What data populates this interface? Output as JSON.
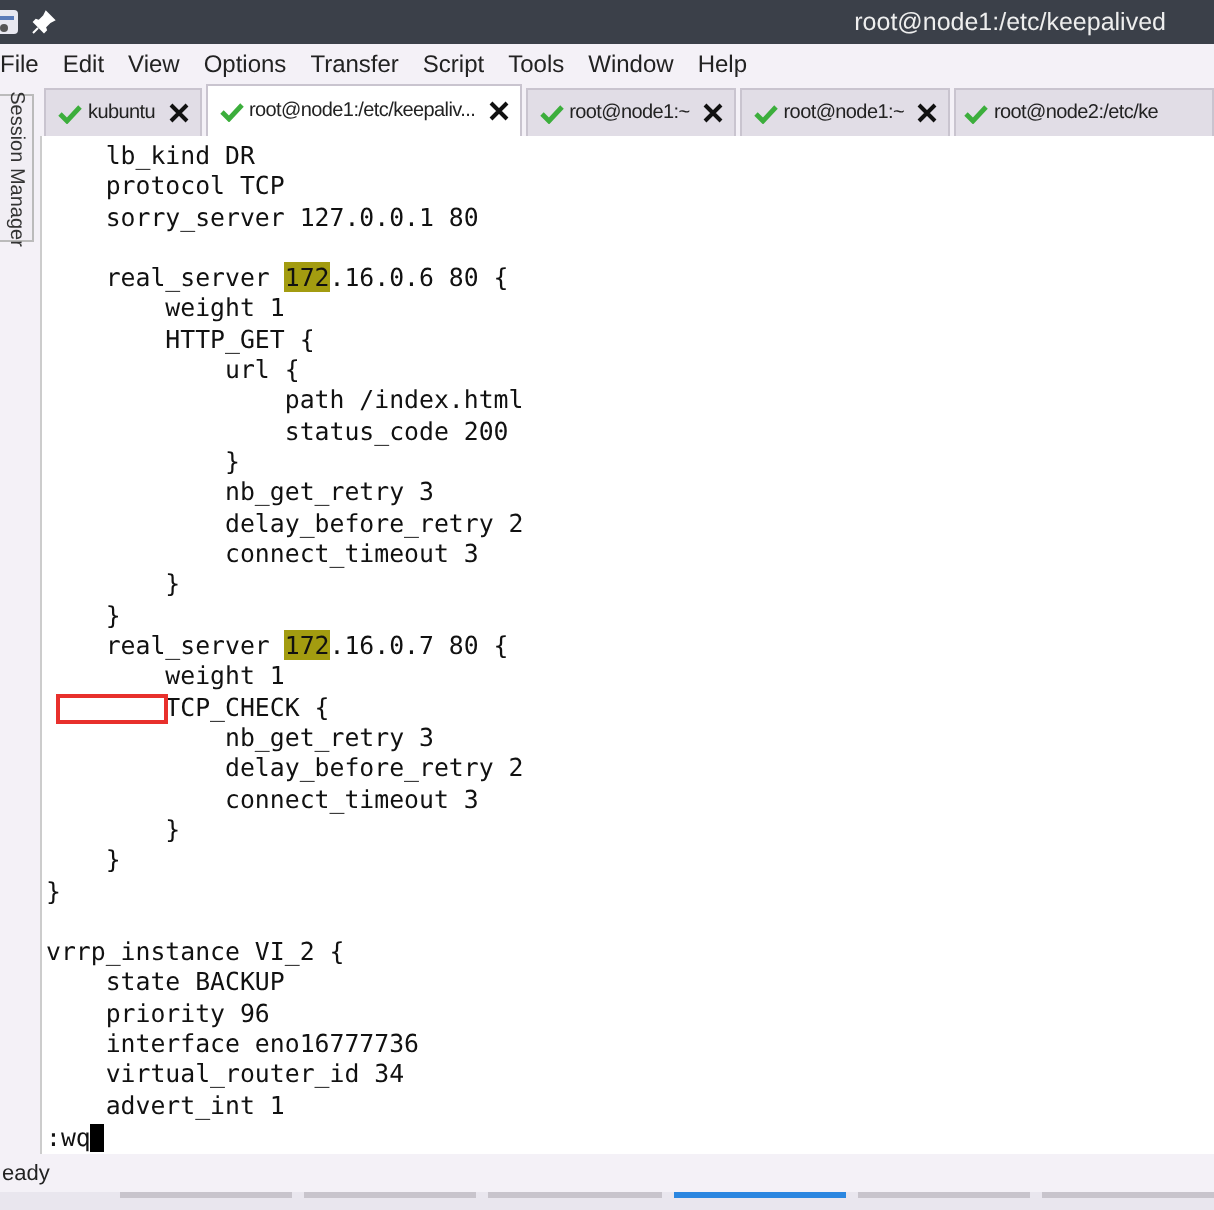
{
  "window": {
    "title": "root@node1:/etc/keepalived"
  },
  "menu": [
    "File",
    "Edit",
    "View",
    "Options",
    "Transfer",
    "Script",
    "Tools",
    "Window",
    "Help"
  ],
  "side_panel": {
    "label": "Session Manager"
  },
  "tabs": [
    {
      "label": "kubuntu",
      "selected": false,
      "connected": true
    },
    {
      "label": "root@node1:/etc/keepaliv...",
      "selected": true,
      "connected": true
    },
    {
      "label": "root@node1:~",
      "selected": false,
      "connected": true
    },
    {
      "label": "root@node1:~",
      "selected": false,
      "connected": true
    },
    {
      "label": "root@node2:/etc/ke",
      "selected": false,
      "connected": true
    }
  ],
  "terminal": {
    "lines": [
      {
        "segments": [
          {
            "text": "    lb_kind DR"
          }
        ]
      },
      {
        "segments": [
          {
            "text": "    protocol TCP"
          }
        ]
      },
      {
        "segments": [
          {
            "text": "    sorry_server 127.0.0.1 80"
          }
        ]
      },
      {
        "kind": "blank"
      },
      {
        "segments": [
          {
            "text": "    real_server "
          },
          {
            "text": "172",
            "highlighted": true
          },
          {
            "text": ".16.0.6 80 {"
          }
        ]
      },
      {
        "segments": [
          {
            "text": "        weight 1"
          }
        ]
      },
      {
        "segments": [
          {
            "text": "        HTTP_GET {"
          }
        ]
      },
      {
        "segments": [
          {
            "text": "            url {"
          }
        ]
      },
      {
        "segments": [
          {
            "text": "                path /index.html"
          }
        ]
      },
      {
        "segments": [
          {
            "text": "                status_code 200"
          }
        ]
      },
      {
        "segments": [
          {
            "text": "            }"
          }
        ]
      },
      {
        "segments": [
          {
            "text": "            nb_get_retry 3"
          }
        ]
      },
      {
        "segments": [
          {
            "text": "            delay_before_retry 2"
          }
        ]
      },
      {
        "segments": [
          {
            "text": "            connect_timeout 3"
          }
        ]
      },
      {
        "segments": [
          {
            "text": "        }"
          }
        ]
      },
      {
        "segments": [
          {
            "text": "    }"
          }
        ]
      },
      {
        "segments": [
          {
            "text": "    real_server "
          },
          {
            "text": "172",
            "highlighted": true
          },
          {
            "text": ".16.0.7 80 {"
          }
        ]
      },
      {
        "segments": [
          {
            "text": "        weight 1"
          }
        ]
      },
      {
        "segments": [
          {
            "text": "        TCP_CHECK {"
          }
        ],
        "annotated": true
      },
      {
        "segments": [
          {
            "text": "            nb_get_retry 3"
          }
        ]
      },
      {
        "segments": [
          {
            "text": "            delay_before_retry 2"
          }
        ]
      },
      {
        "segments": [
          {
            "text": "            connect_timeout 3"
          }
        ]
      },
      {
        "segments": [
          {
            "text": "        }"
          }
        ]
      },
      {
        "segments": [
          {
            "text": "    }"
          }
        ]
      },
      {
        "segments": [
          {
            "text": "}"
          }
        ]
      },
      {
        "kind": "blank"
      },
      {
        "segments": [
          {
            "text": "vrrp_instance VI_2 {"
          }
        ]
      },
      {
        "segments": [
          {
            "text": "    state BACKUP"
          }
        ]
      },
      {
        "segments": [
          {
            "text": "    priority 96"
          }
        ]
      },
      {
        "segments": [
          {
            "text": "    interface eno16777736"
          }
        ]
      },
      {
        "segments": [
          {
            "text": "    virtual_router_id 34"
          }
        ]
      },
      {
        "segments": [
          {
            "text": "    advert_int 1"
          }
        ]
      }
    ],
    "command_line": ":wq"
  },
  "status_bar": {
    "text": "eady"
  },
  "taskbar": {
    "items": [
      {
        "selected": false
      },
      {
        "selected": false
      },
      {
        "selected": false
      },
      {
        "selected": true
      },
      {
        "selected": false
      },
      {
        "selected": false
      }
    ]
  }
}
